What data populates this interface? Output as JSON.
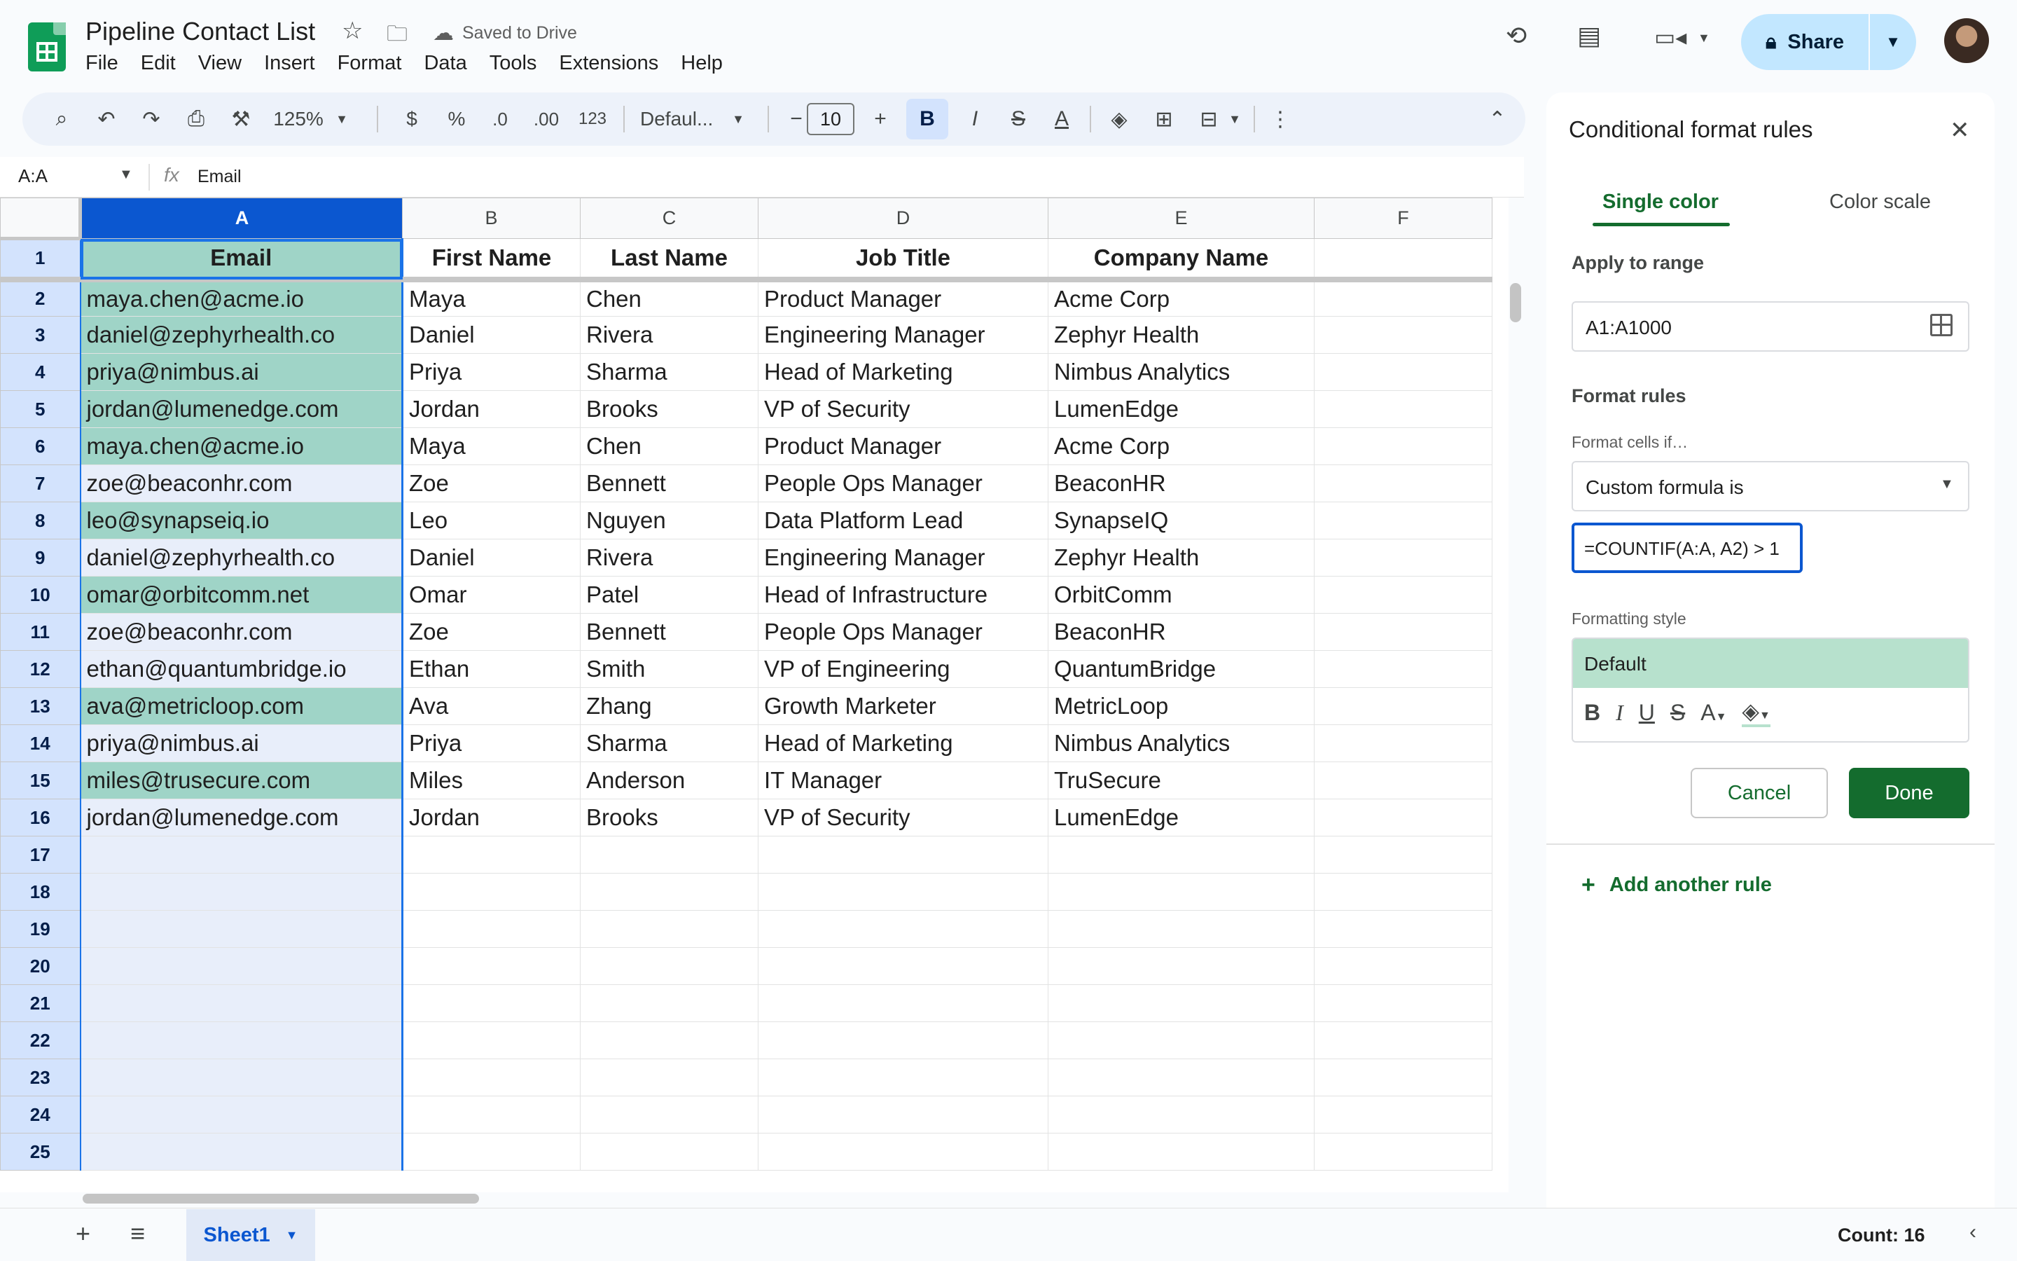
{
  "app": {
    "doc_title": "Pipeline Contact List",
    "saved_status": "Saved to Drive",
    "menu": [
      "File",
      "Edit",
      "View",
      "Insert",
      "Format",
      "Data",
      "Tools",
      "Extensions",
      "Help"
    ],
    "share_label": "Share"
  },
  "toolbar": {
    "zoom": "125%",
    "currency": "$",
    "percent": "%",
    "dec_less": ".0",
    "dec_more": ".00",
    "number_format": "123",
    "font": "Defaul...",
    "font_size": "10",
    "bold": "B",
    "italic": "I",
    "strike": "S",
    "text_color": "A"
  },
  "formula_bar": {
    "name_box": "A:A",
    "fx": "fx",
    "value": "Email"
  },
  "sheet": {
    "columns": [
      "A",
      "B",
      "C",
      "D",
      "E",
      "F"
    ],
    "header_row": [
      "Email",
      "First Name",
      "Last Name",
      "Job Title",
      "Company Name",
      ""
    ],
    "rows": [
      [
        "maya.chen@acme.io",
        "Maya",
        "Chen",
        "Product Manager",
        "Acme Corp"
      ],
      [
        "daniel@zephyrhealth.co",
        "Daniel",
        "Rivera",
        "Engineering Manager",
        "Zephyr Health"
      ],
      [
        "priya@nimbus.ai",
        "Priya",
        "Sharma",
        "Head of Marketing",
        "Nimbus Analytics"
      ],
      [
        "jordan@lumenedge.com",
        "Jordan",
        "Brooks",
        "VP of Security",
        "LumenEdge"
      ],
      [
        "maya.chen@acme.io",
        "Maya",
        "Chen",
        "Product Manager",
        "Acme Corp"
      ],
      [
        "zoe@beaconhr.com",
        "Zoe",
        "Bennett",
        "People Ops Manager",
        "BeaconHR"
      ],
      [
        "leo@synapseiq.io",
        "Leo",
        "Nguyen",
        "Data Platform Lead",
        "SynapseIQ"
      ],
      [
        "daniel@zephyrhealth.co",
        "Daniel",
        "Rivera",
        "Engineering Manager",
        "Zephyr Health"
      ],
      [
        "omar@orbitcomm.net",
        "Omar",
        "Patel",
        "Head of Infrastructure",
        "OrbitComm"
      ],
      [
        "zoe@beaconhr.com",
        "Zoe",
        "Bennett",
        "People Ops Manager",
        "BeaconHR"
      ],
      [
        "ethan@quantumbridge.io",
        "Ethan",
        "Smith",
        "VP of Engineering",
        "QuantumBridge"
      ],
      [
        "ava@metricloop.com",
        "Ava",
        "Zhang",
        "Growth Marketer",
        "MetricLoop"
      ],
      [
        "priya@nimbus.ai",
        "Priya",
        "Sharma",
        "Head of Marketing",
        "Nimbus Analytics"
      ],
      [
        "miles@trusecure.com",
        "Miles",
        "Anderson",
        "IT Manager",
        "TruSecure"
      ],
      [
        "jordan@lumenedge.com",
        "Jordan",
        "Brooks",
        "VP of Security",
        "LumenEdge"
      ]
    ],
    "highlighted_rows": [
      1,
      2,
      3,
      4,
      5,
      7,
      9,
      12,
      14
    ],
    "row_numbers": [
      "1",
      "2",
      "3",
      "4",
      "5",
      "6",
      "7",
      "8",
      "9",
      "10",
      "11",
      "12",
      "13",
      "14",
      "15",
      "16",
      "17",
      "18",
      "19",
      "20",
      "21",
      "22",
      "23",
      "24",
      "25"
    ],
    "highlight_color": "#9fd4c7",
    "selection_color": "#1a73e8"
  },
  "bottom": {
    "sheet_tab": "Sheet1",
    "status": "Count: 16"
  },
  "panel": {
    "title": "Conditional format rules",
    "tabs": [
      "Single color",
      "Color scale"
    ],
    "apply_label": "Apply to range",
    "range": "A1:A1000",
    "rules_label": "Format rules",
    "condition_label": "Format cells if…",
    "condition": "Custom formula is",
    "formula": "=COUNTIF(A:A, A2) > 1",
    "style_label": "Formatting style",
    "style_preview": "Default",
    "style_color": "#b7e1cd",
    "cancel": "Cancel",
    "done": "Done",
    "add_rule": "Add another rule",
    "accent": "#146c2e"
  }
}
